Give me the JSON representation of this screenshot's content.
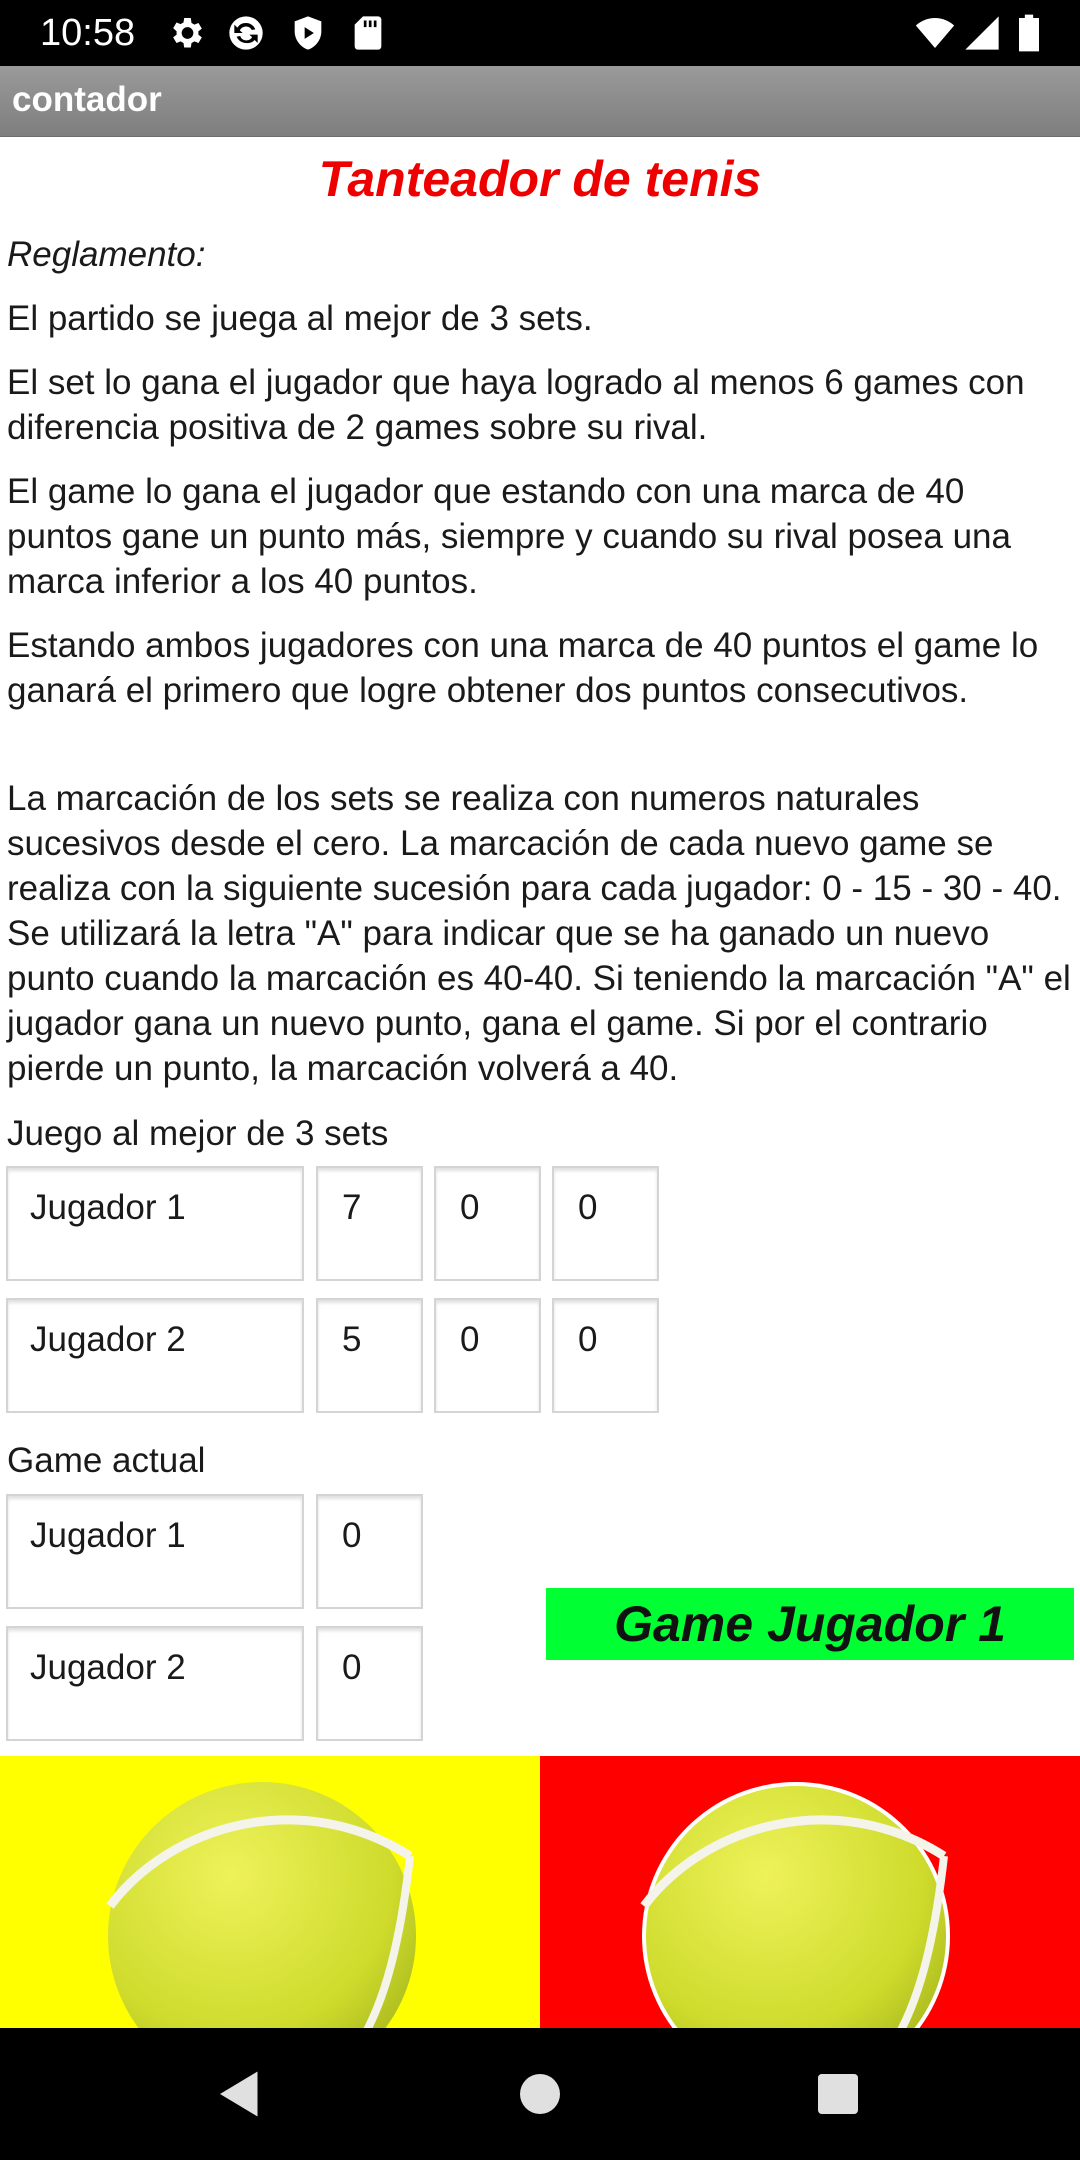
{
  "status_bar": {
    "time": "10:58",
    "icons": [
      "gear-icon",
      "sync-icon",
      "play-shield-icon",
      "sd-card-icon",
      "wifi-icon",
      "signal-icon",
      "battery-icon"
    ]
  },
  "app_bar": {
    "title": "contador"
  },
  "content": {
    "heading": "Tanteador de tenis",
    "rules_label": "Reglamento:",
    "paragraphs": [
      "El partido se juega al mejor de 3 sets.",
      "El set lo gana el jugador que haya logrado al menos 6 games con diferencia positiva de 2 games sobre su rival.",
      "El game lo gana el jugador que estando con una marca de 40 puntos gane un punto más, siempre y cuando su rival posea una marca inferior a los 40 puntos.",
      "Estando ambos jugadores con una marca de 40 puntos el game lo ganará el primero que logre obtener dos puntos consecutivos.",
      "La marcación de los sets se realiza con numeros naturales sucesivos desde el cero. La marcación de cada nuevo game se realiza con la siguiente sucesión para cada jugador: 0 - 15 - 30 - 40. Se utilizará la letra \"A\" para indicar que se ha ganado un nuevo punto cuando la marcación es 40-40. Si teniendo la marcación \"A\" el jugador gana un nuevo punto, gana el game. Si por el contrario pierde un punto, la marcación volverá a 40."
    ]
  },
  "sets": {
    "label": "Juego al mejor de 3 sets",
    "rows": [
      {
        "player": "Jugador 1",
        "scores": [
          "7",
          "0",
          "0"
        ]
      },
      {
        "player": "Jugador 2",
        "scores": [
          "5",
          "0",
          "0"
        ]
      }
    ]
  },
  "current_game": {
    "label": "Game actual",
    "rows": [
      {
        "player": "Jugador 1",
        "score": "0"
      },
      {
        "player": "Jugador 2",
        "score": "0"
      }
    ]
  },
  "banner": {
    "text": "Game Jugador 1",
    "color": "#00ff33"
  },
  "buttons": [
    {
      "icon": "tennis-ball-icon",
      "background": "#ffff00"
    },
    {
      "icon": "tennis-ball-icon",
      "background": "#ff0000"
    }
  ],
  "nav_bar": {
    "icons": [
      "back-icon",
      "home-icon",
      "recents-icon"
    ]
  }
}
